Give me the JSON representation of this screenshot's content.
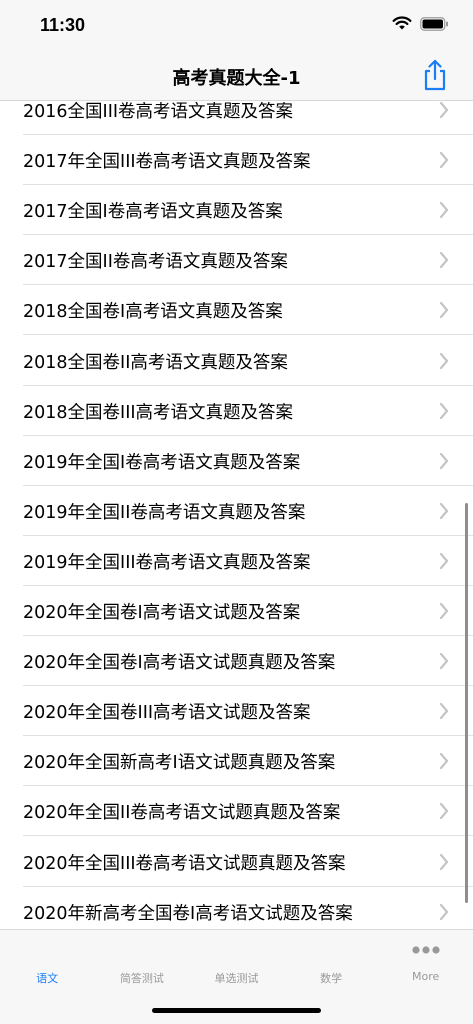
{
  "status_bar": {
    "time": "11:30"
  },
  "nav": {
    "title": "高考真题大全-1"
  },
  "list": {
    "items": [
      "2016全国III卷高考语文真题及答案",
      "2017年全国III卷高考语文真题及答案",
      "2017全国I卷高考语文真题及答案",
      "2017全国II卷高考语文真题及答案",
      "2018全国卷I高考语文真题及答案",
      "2018全国卷II高考语文真题及答案",
      "2018全国卷III高考语文真题及答案",
      "2019年全国I卷高考语文真题及答案",
      "2019年全国II卷高考语文真题及答案",
      "2019年全国III卷高考语文真题及答案",
      "2020年全国卷I高考语文试题及答案",
      "2020年全国卷I高考语文试题真题及答案",
      "2020年全国卷III高考语文试题及答案",
      "2020年全国新高考I语文试题真题及答案",
      "2020年全国II卷高考语文试题真题及答案",
      "2020年全国III卷高考语文试题真题及答案",
      "2020年新高考全国卷I高考语文试题及答案"
    ]
  },
  "tabs": [
    {
      "label": "语文",
      "active": true
    },
    {
      "label": "简答测试",
      "active": false
    },
    {
      "label": "单选测试",
      "active": false
    },
    {
      "label": "数学",
      "active": false
    },
    {
      "label": "More",
      "active": false,
      "icon": "more-dots-icon"
    }
  ],
  "colors": {
    "accent": "#1a7ef5",
    "inactive": "#999999",
    "chevron": "#c4c4c7"
  }
}
